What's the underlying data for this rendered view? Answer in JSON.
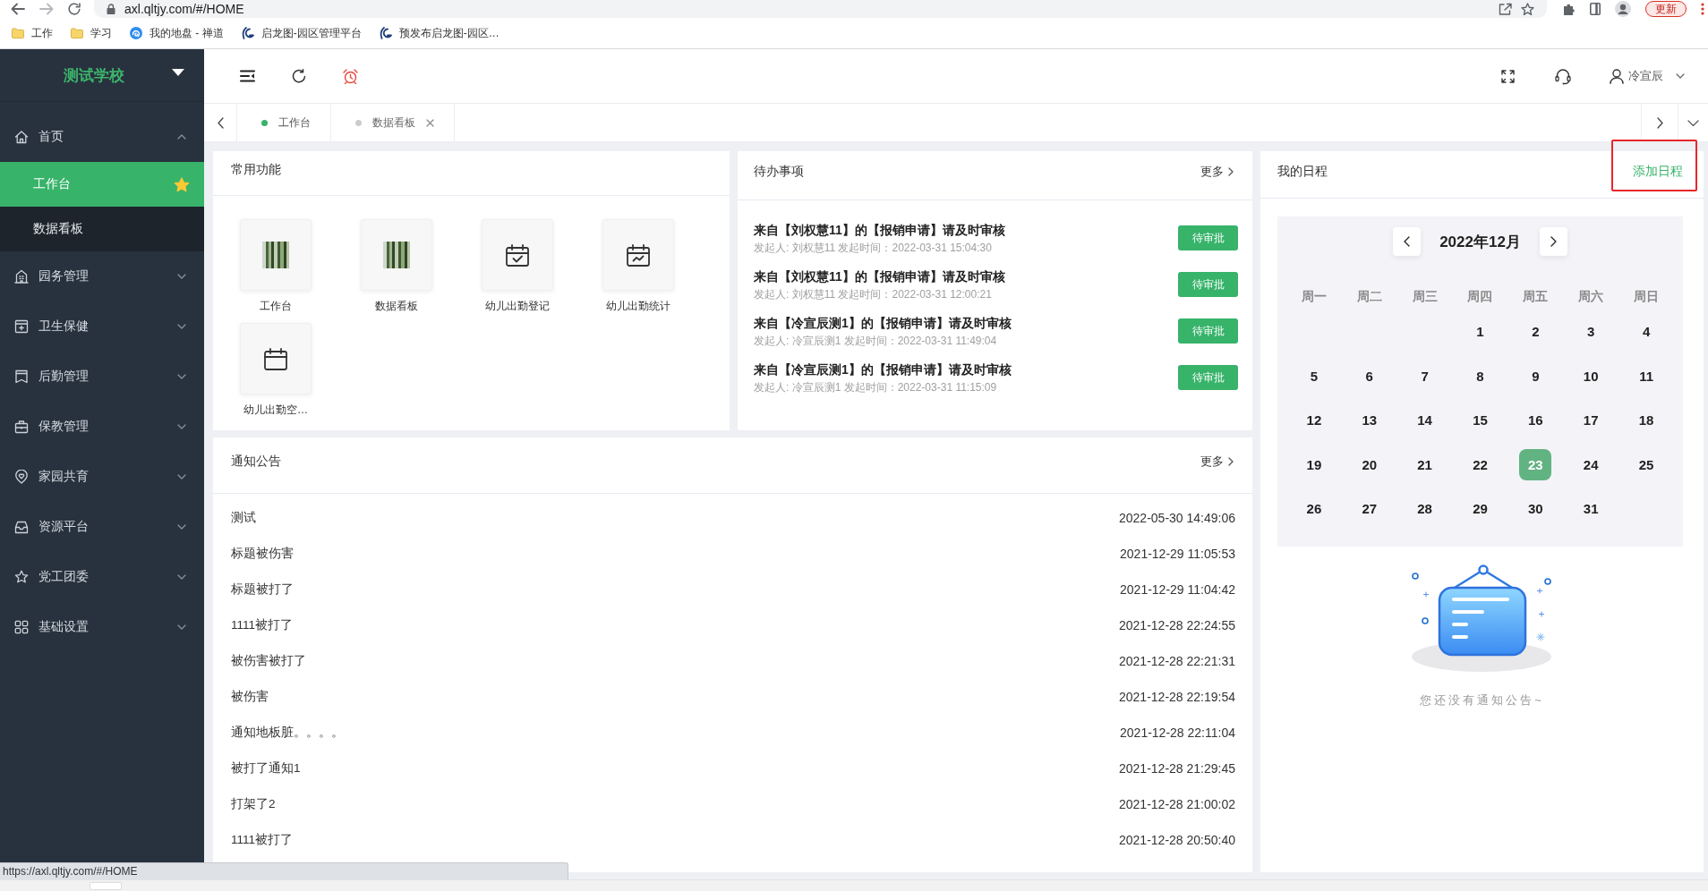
{
  "browser": {
    "address": "axl.qltjy.com/#/HOME",
    "bookmarks": [
      {
        "label": "工作",
        "kind": "folder"
      },
      {
        "label": "学习",
        "kind": "folder"
      },
      {
        "label": "我的地盘 - 禅道",
        "kind": "swirl"
      },
      {
        "label": "启龙图-园区管理平台",
        "kind": "logo"
      },
      {
        "label": "预发布启龙图-园区…",
        "kind": "logo"
      }
    ],
    "update_button": "更新",
    "status_url": "https://axl.qltjy.com/#/HOME"
  },
  "sidebar": {
    "school": "测试学校",
    "items": [
      {
        "label": "首页",
        "expanded": true,
        "children": [
          {
            "label": "工作台",
            "selected": true
          },
          {
            "label": "数据看板",
            "selected": false
          }
        ]
      },
      {
        "label": "园务管理",
        "expanded": false
      },
      {
        "label": "卫生保健",
        "expanded": false
      },
      {
        "label": "后勤管理",
        "expanded": false
      },
      {
        "label": "保教管理",
        "expanded": false
      },
      {
        "label": "家园共育",
        "expanded": false
      },
      {
        "label": "资源平台",
        "expanded": false
      },
      {
        "label": "党工团委",
        "expanded": false
      },
      {
        "label": "基础设置",
        "expanded": false
      }
    ]
  },
  "header": {
    "user": "冷宣辰"
  },
  "tabs": [
    {
      "label": "工作台",
      "selected": true,
      "closable": false
    },
    {
      "label": "数据看板",
      "selected": false,
      "closable": true
    }
  ],
  "shortcuts": {
    "title": "常用功能",
    "items": [
      {
        "label": "工作台",
        "kind": "photo"
      },
      {
        "label": "数据看板",
        "kind": "photo"
      },
      {
        "label": "幼儿出勤登记",
        "kind": "calendar-check"
      },
      {
        "label": "幼儿出勤统计",
        "kind": "calendar-chart"
      },
      {
        "label": "幼儿出勤空…",
        "kind": "calendar"
      }
    ]
  },
  "todo": {
    "title": "待办事项",
    "more": "更多",
    "items": [
      {
        "title": "来自【刘权慧11】的【报销申请】请及时审核",
        "meta": "发起人: 刘权慧11 发起时间：2022-03-31 15:04:30",
        "status": "待审批"
      },
      {
        "title": "来自【刘权慧11】的【报销申请】请及时审核",
        "meta": "发起人: 刘权慧11 发起时间：2022-03-31 12:00:21",
        "status": "待审批"
      },
      {
        "title": "来自【冷宣辰测1】的【报销申请】请及时审核",
        "meta": "发起人: 冷宣辰测1 发起时间：2022-03-31 11:49:04",
        "status": "待审批"
      },
      {
        "title": "来自【冷宣辰测1】的【报销申请】请及时审核",
        "meta": "发起人: 冷宣辰测1 发起时间：2022-03-31 11:15:09",
        "status": "待审批"
      }
    ]
  },
  "schedule": {
    "title": "我的日程",
    "add_button": {
      "label": "添加日程",
      "highlighted": true
    },
    "month": "2022年12月",
    "weekdays": [
      "周一",
      "周二",
      "周三",
      "周四",
      "周五",
      "周六",
      "周日"
    ],
    "weeks": [
      [
        {
          "day": "1",
          "selected": false
        },
        {
          "day": "2",
          "selected": false
        },
        {
          "day": "3",
          "selected": false
        },
        {
          "day": "4",
          "selected": false
        }
      ],
      [
        {
          "day": "5",
          "selected": false
        },
        {
          "day": "6",
          "selected": false
        },
        {
          "day": "7",
          "selected": false
        },
        {
          "day": "8",
          "selected": false
        },
        {
          "day": "9",
          "selected": false
        },
        {
          "day": "10",
          "selected": false
        },
        {
          "day": "11",
          "selected": false
        }
      ],
      [
        {
          "day": "12",
          "selected": false
        },
        {
          "day": "13",
          "selected": false
        },
        {
          "day": "14",
          "selected": false
        },
        {
          "day": "15",
          "selected": false
        },
        {
          "day": "16",
          "selected": false
        },
        {
          "day": "17",
          "selected": false
        },
        {
          "day": "18",
          "selected": false
        }
      ],
      [
        {
          "day": "19",
          "selected": false
        },
        {
          "day": "20",
          "selected": false
        },
        {
          "day": "21",
          "selected": false
        },
        {
          "day": "22",
          "selected": false
        },
        {
          "day": "23",
          "selected": true
        },
        {
          "day": "24",
          "selected": false
        },
        {
          "day": "25",
          "selected": false
        }
      ],
      [
        {
          "day": "26",
          "selected": false
        },
        {
          "day": "27",
          "selected": false
        },
        {
          "day": "28",
          "selected": false
        },
        {
          "day": "29",
          "selected": false
        },
        {
          "day": "30",
          "selected": false
        },
        {
          "day": "31",
          "selected": false
        }
      ]
    ],
    "empty_text": "您还没有通知公告~"
  },
  "notices": {
    "title": "通知公告",
    "more": "更多",
    "rows": [
      {
        "title": "测试",
        "time": "2022-05-30 14:49:06"
      },
      {
        "title": "标题被伤害",
        "time": "2021-12-29 11:05:53"
      },
      {
        "title": "标题被打了",
        "time": "2021-12-29 11:04:42"
      },
      {
        "title": "1111被打了",
        "time": "2021-12-28 22:24:55"
      },
      {
        "title": "被伤害被打了",
        "time": "2021-12-28 22:21:31"
      },
      {
        "title": "被伤害",
        "time": "2021-12-28 22:19:54"
      },
      {
        "title": "通知地板脏。。。。",
        "time": "2021-12-28 22:11:04"
      },
      {
        "title": "被打了通知1",
        "time": "2021-12-28 21:29:45"
      },
      {
        "title": "打架了2",
        "time": "2021-12-28 21:00:02"
      },
      {
        "title": "1111被打了",
        "time": "2021-12-28 20:50:40"
      }
    ]
  }
}
